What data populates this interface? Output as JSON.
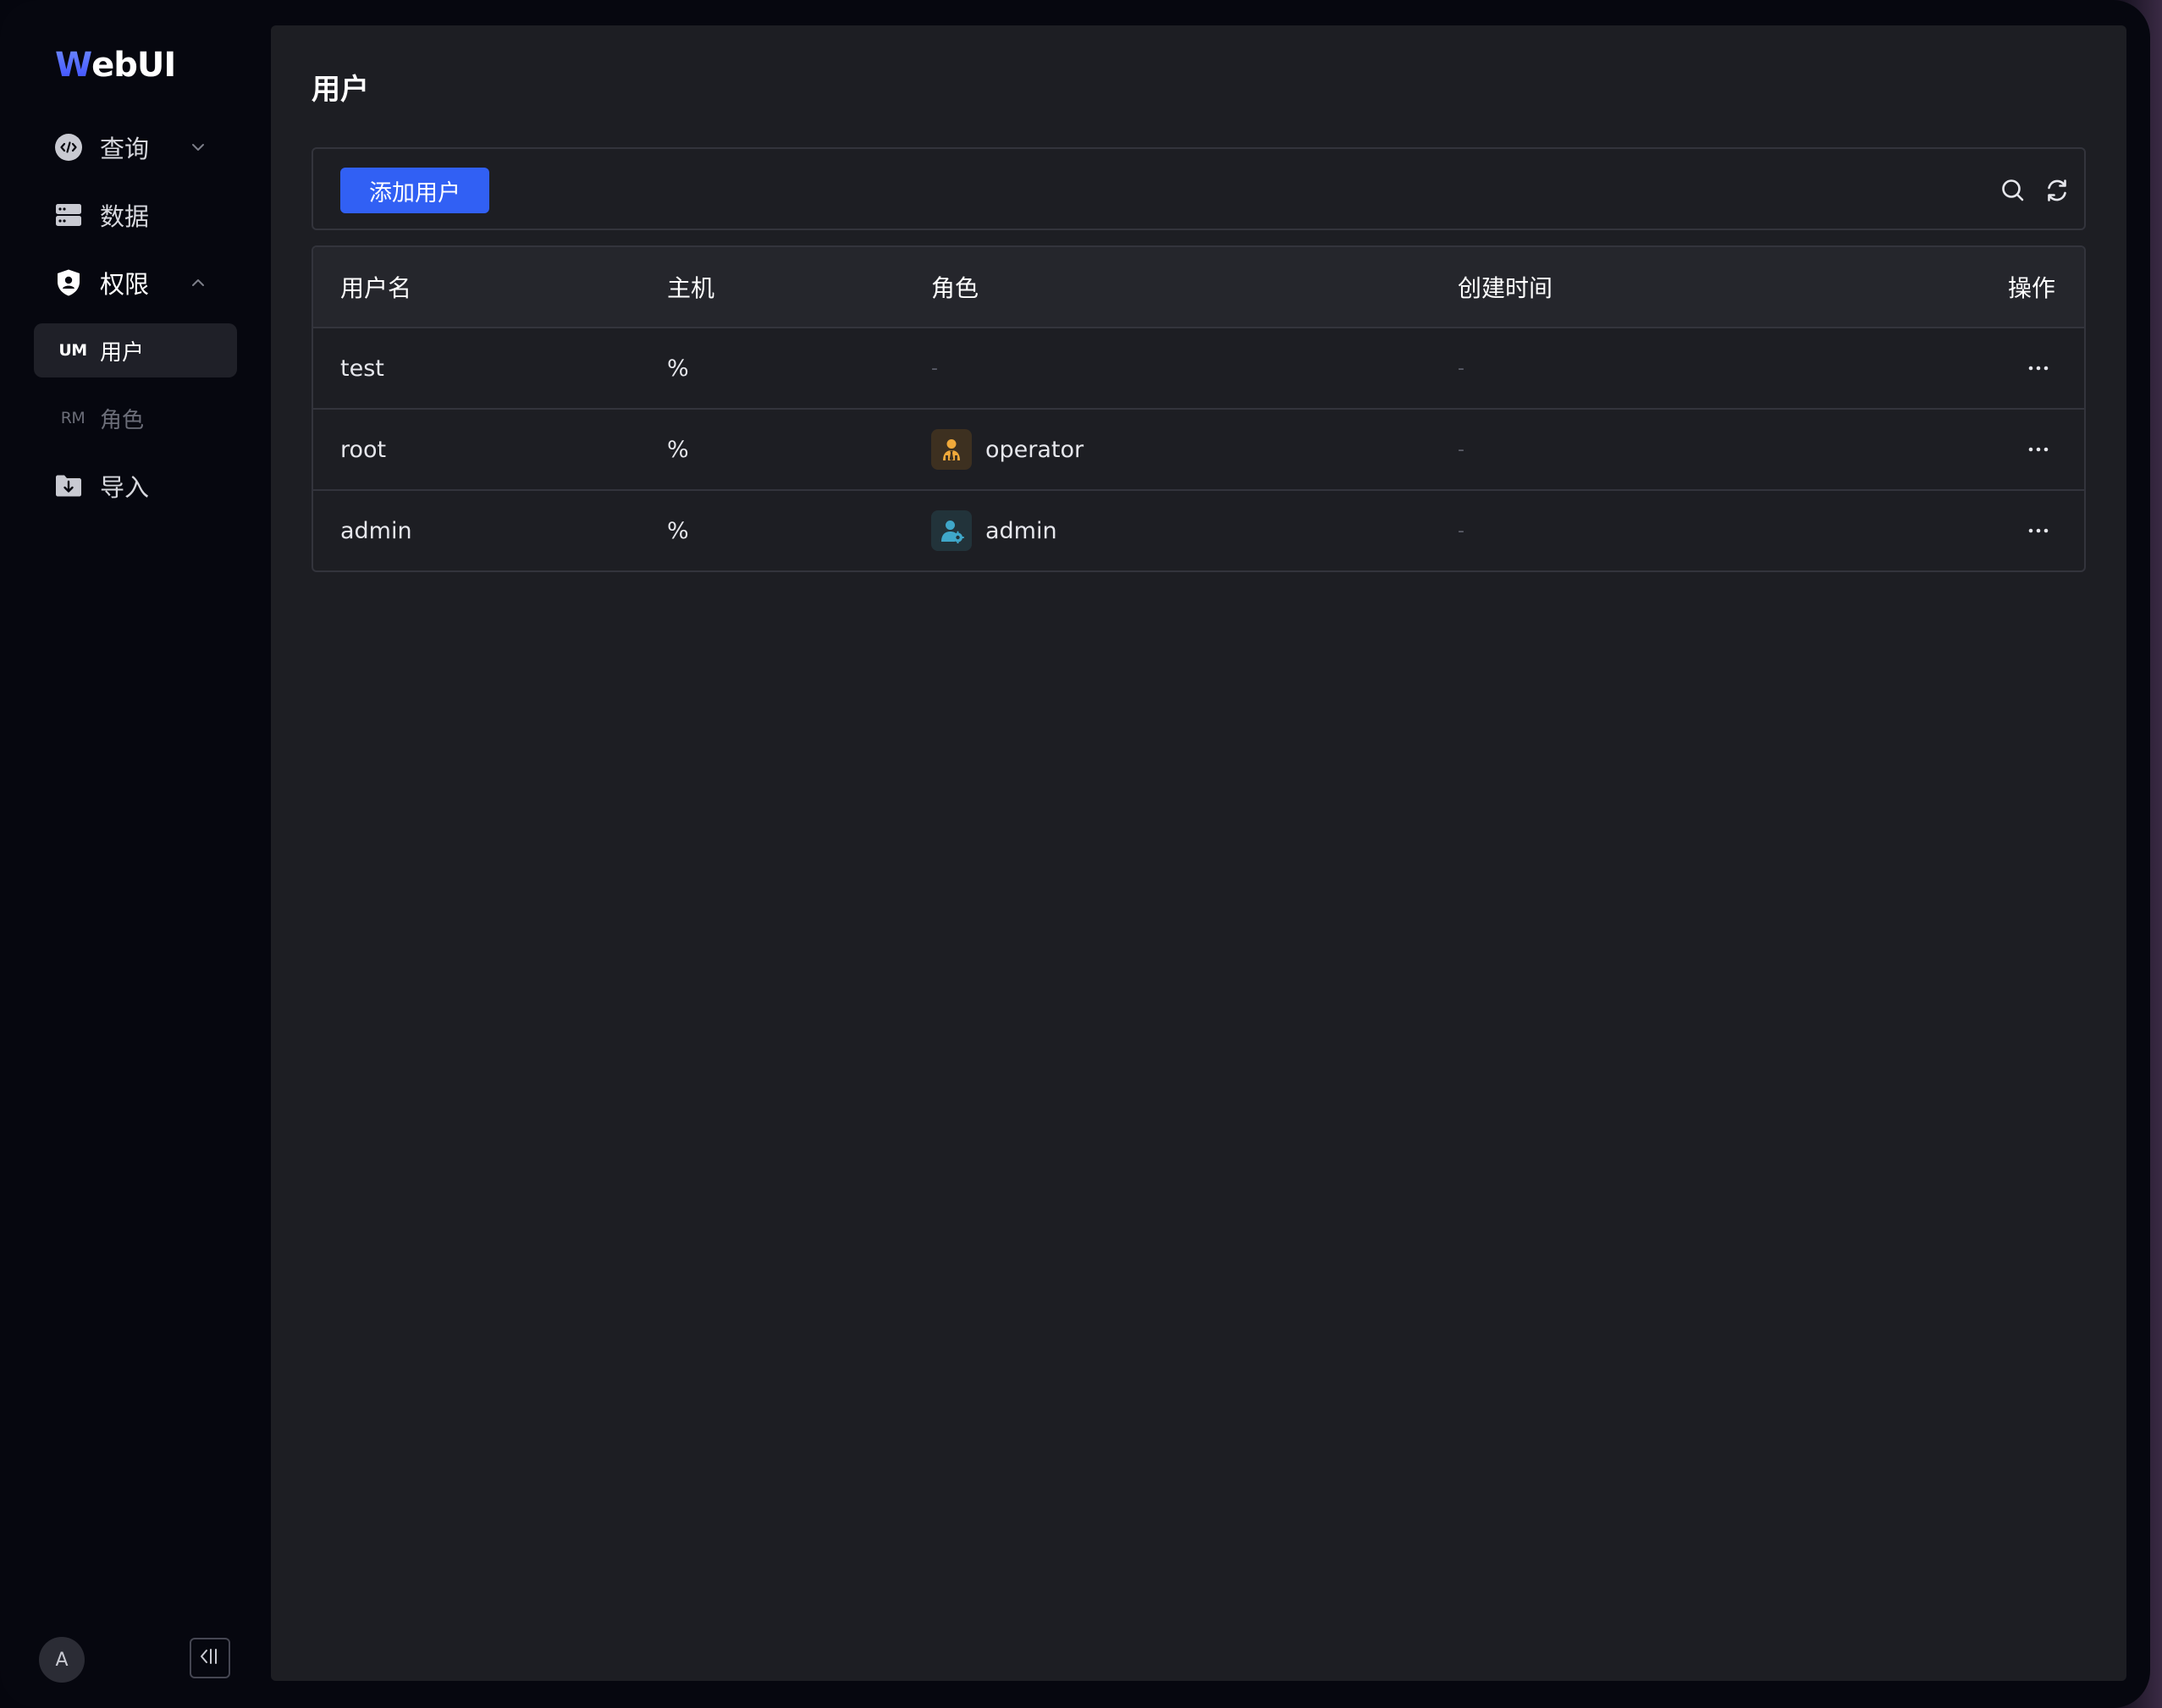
{
  "app": {
    "logo_first": "W",
    "logo_rest": "ebUI"
  },
  "sidebar": {
    "items": [
      {
        "label": "查询",
        "icon": "query-code-icon",
        "expandable": true,
        "expanded": false
      },
      {
        "label": "数据",
        "icon": "database-icon",
        "expandable": false
      },
      {
        "label": "权限",
        "icon": "shield-user-icon",
        "expandable": true,
        "expanded": true
      },
      {
        "label": "导入",
        "icon": "folder-import-icon",
        "expandable": false
      }
    ],
    "sub_items": [
      {
        "abbr": "UM",
        "label": "用户",
        "active": true
      },
      {
        "abbr": "RM",
        "label": "角色",
        "active": false
      }
    ],
    "avatar_initial": "A"
  },
  "page": {
    "title": "用户",
    "add_button": "添加用户"
  },
  "table": {
    "headers": {
      "username": "用户名",
      "host": "主机",
      "role": "角色",
      "created": "创建时间",
      "actions": "操作"
    },
    "rows": [
      {
        "username": "test",
        "host": "%",
        "role": "-",
        "role_icon": null,
        "created": "-",
        "actions": "···"
      },
      {
        "username": "root",
        "host": "%",
        "role": "operator",
        "role_icon": "operator-role-icon",
        "created": "-",
        "actions": "···"
      },
      {
        "username": "admin",
        "host": "%",
        "role": "admin",
        "role_icon": "admin-role-icon",
        "created": "-",
        "actions": "···"
      }
    ]
  },
  "colors": {
    "accent": "#3160f4",
    "operator": "#f0a93a",
    "admin": "#3fa7c9"
  }
}
